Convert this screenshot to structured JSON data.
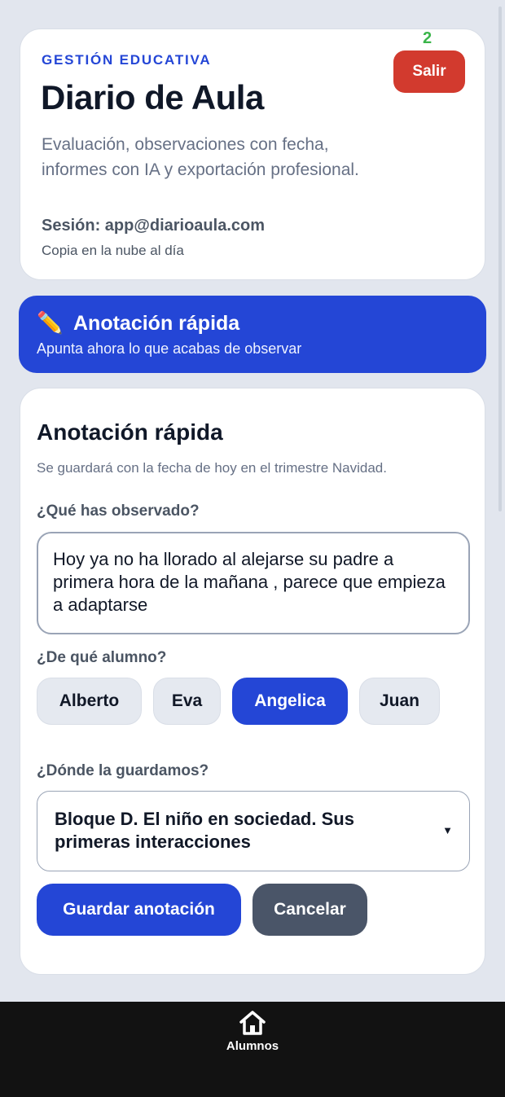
{
  "header": {
    "eyebrow": "GESTIÓN EDUCATIVA",
    "title": "Diario de Aula",
    "description": "Evaluación, observaciones con fecha, informes con IA y exportación profesional.",
    "session": "Sesión: app@diarioaula.com",
    "sync_status": "Copia en la nube al día",
    "logout_label": "Salir",
    "badge": "2"
  },
  "banner": {
    "icon": "pencil-icon",
    "title": "Anotación rápida",
    "subtitle": "Apunta ahora lo que acabas de observar"
  },
  "form": {
    "title": "Anotación rápida",
    "subtitle": "Se guardará con la fecha de hoy en el trimestre Navidad.",
    "observation_label": "¿Qué has observado?",
    "observation_value": "Hoy ya no ha llorado al alejarse su padre a primera hora de la mañana , parece que empieza a adaptarse",
    "student_label": "¿De qué alumno?",
    "students": [
      "Alberto",
      "Eva",
      "Angelica",
      "Juan"
    ],
    "selected_student": "Angelica",
    "location_label": "¿Dónde la guardamos?",
    "location_value": "Bloque D. El niño en sociedad. Sus primeras interacciones",
    "save_label": "Guardar anotación",
    "cancel_label": "Cancelar"
  },
  "bottom_nav": {
    "items": [
      {
        "label": "Alumnos",
        "icon": "home-icon"
      }
    ]
  },
  "colors": {
    "accent": "#2446d6",
    "danger": "#d23a2e",
    "secondary": "#4a5568",
    "background": "#e2e6ee",
    "nav_background": "#121212"
  }
}
